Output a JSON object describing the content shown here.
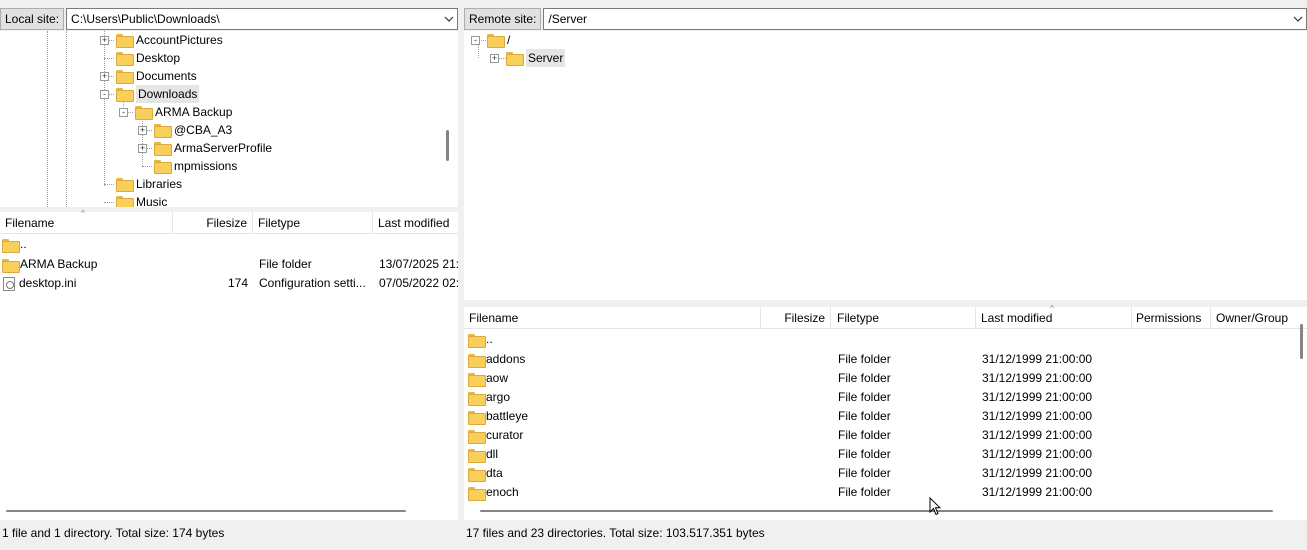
{
  "local": {
    "label": "Local site:",
    "path": "C:\\Users\\Public\\Downloads\\",
    "tree": [
      {
        "label": "AccountPictures",
        "expander": "+"
      },
      {
        "label": "Desktop",
        "expander": ""
      },
      {
        "label": "Documents",
        "expander": "+"
      },
      {
        "label": "Downloads",
        "expander": "-"
      },
      {
        "label": "ARMA Backup",
        "expander": "-"
      },
      {
        "label": "@CBA_A3",
        "expander": "+"
      },
      {
        "label": "ArmaServerProfile",
        "expander": "+"
      },
      {
        "label": "mpmissions",
        "expander": ""
      },
      {
        "label": "Libraries",
        "expander": ""
      },
      {
        "label": "Music",
        "expander": ""
      }
    ],
    "columns": {
      "filename": "Filename",
      "filesize": "Filesize",
      "filetype": "Filetype",
      "modified": "Last modified"
    },
    "rows": [
      {
        "name": "..",
        "size": "",
        "type": "",
        "modified": "",
        "icon": "folder-icon"
      },
      {
        "name": "ARMA Backup",
        "size": "",
        "type": "File folder",
        "modified": "13/07/2025 21:",
        "icon": "folder-icon"
      },
      {
        "name": "desktop.ini",
        "size": "174",
        "type": "Configuration setti...",
        "modified": "07/05/2022 02:",
        "icon": "config-file-icon"
      }
    ],
    "status": "1 file and 1 directory. Total size: 174 bytes"
  },
  "remote": {
    "label": "Remote site:",
    "path": "/Server",
    "tree": [
      {
        "label": "/",
        "expander": "-"
      },
      {
        "label": "Server",
        "expander": "+"
      }
    ],
    "columns": {
      "filename": "Filename",
      "filesize": "Filesize",
      "filetype": "Filetype",
      "modified": "Last modified",
      "permissions": "Permissions",
      "owner": "Owner/Group"
    },
    "rows": [
      {
        "name": "..",
        "type": "",
        "modified": ""
      },
      {
        "name": "addons",
        "type": "File folder",
        "modified": "31/12/1999 21:00:00"
      },
      {
        "name": "aow",
        "type": "File folder",
        "modified": "31/12/1999 21:00:00"
      },
      {
        "name": "argo",
        "type": "File folder",
        "modified": "31/12/1999 21:00:00"
      },
      {
        "name": "battleye",
        "type": "File folder",
        "modified": "31/12/1999 21:00:00"
      },
      {
        "name": "curator",
        "type": "File folder",
        "modified": "31/12/1999 21:00:00"
      },
      {
        "name": "dll",
        "type": "File folder",
        "modified": "31/12/1999 21:00:00"
      },
      {
        "name": "dta",
        "type": "File folder",
        "modified": "31/12/1999 21:00:00"
      },
      {
        "name": "enoch",
        "type": "File folder",
        "modified": "31/12/1999 21:00:00"
      }
    ],
    "status": "17 files and 23 directories. Total size: 103.517.351 bytes"
  },
  "colors": {
    "folder": "#f7cf5a",
    "selected_tree_bg": "#e5e5e5"
  }
}
